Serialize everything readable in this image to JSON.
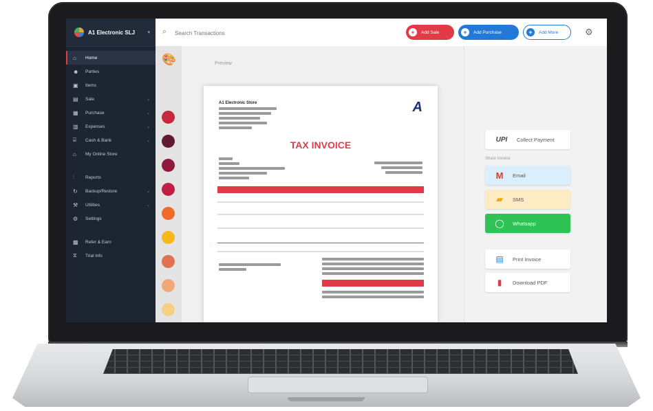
{
  "brand": {
    "name": "A1 Electronic SLJ"
  },
  "sidebar": {
    "items": [
      {
        "label": "Home",
        "icon": "home-icon",
        "active": true
      },
      {
        "label": "Parties",
        "icon": "users-icon"
      },
      {
        "label": "Items",
        "icon": "box-icon"
      },
      {
        "label": "Sale",
        "icon": "receipt-icon",
        "chevron": true
      },
      {
        "label": "Purchase",
        "icon": "cart-icon",
        "chevron": true
      },
      {
        "label": "Expenses",
        "icon": "wallet-icon",
        "chevron": true
      },
      {
        "label": "Cash & Bank",
        "icon": "bank-icon",
        "chevron": true
      },
      {
        "label": "My Online Store",
        "icon": "store-icon"
      }
    ],
    "items2": [
      {
        "label": "Reports",
        "icon": "chart-icon"
      },
      {
        "label": "Backup/Restore",
        "icon": "backup-icon",
        "chevron": true
      },
      {
        "label": "Utilities",
        "icon": "wrench-icon",
        "chevron": true
      },
      {
        "label": "Settings",
        "icon": "settings-icon"
      }
    ],
    "items3": [
      {
        "label": "Refer & Earn",
        "icon": "gift-icon"
      },
      {
        "label": "Trial info",
        "icon": "info-icon"
      }
    ]
  },
  "search": {
    "placeholder": "Search Transactions"
  },
  "toolbar": {
    "add_sale": "Add Sale",
    "add_purchase": "Add Purchase",
    "add_more": "Add More"
  },
  "palette": {
    "colors": [
      "#c8283b",
      "#5e1b33",
      "#8f1a3b",
      "#c21e45",
      "#f06a2a",
      "#f7b81c",
      "#e07250",
      "#f2a779",
      "#f5cf84"
    ]
  },
  "preview": {
    "label": "Preview",
    "document": {
      "company": "A1 Electronic Store",
      "logo": "A",
      "title": "TAX INVOICE"
    }
  },
  "actions": {
    "upi": "Collect Payment",
    "share_label": "Share Invoice",
    "email": "Email",
    "sms": "SMS",
    "whatsapp": "Whatsapp",
    "print": "Print Invoice",
    "pdf": "Download PDF"
  }
}
